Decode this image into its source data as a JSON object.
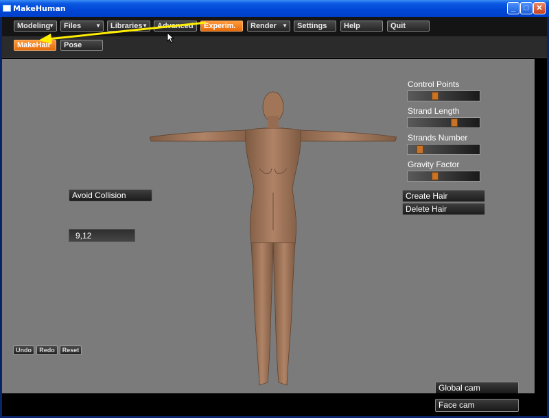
{
  "window": {
    "title": "MakeHuman"
  },
  "menu": {
    "tabs": [
      {
        "label": "Modeling",
        "dropdown": true
      },
      {
        "label": "Files",
        "dropdown": true
      },
      {
        "label": "Libraries",
        "dropdown": true
      },
      {
        "label": "Advanced",
        "dropdown": false
      },
      {
        "label": "Experim.",
        "dropdown": false,
        "active": true
      },
      {
        "label": "Render",
        "dropdown": true
      },
      {
        "label": "Settings",
        "dropdown": false
      },
      {
        "label": "Help",
        "dropdown": false
      },
      {
        "label": "Quit",
        "dropdown": false
      }
    ],
    "subtabs": [
      {
        "label": "MakeHair",
        "active": true
      },
      {
        "label": "Pose",
        "active": false
      }
    ]
  },
  "sliders": [
    {
      "label": "Control Points",
      "level": 0.38
    },
    {
      "label": "Strand Length",
      "level": 0.68
    },
    {
      "label": "Strands Number",
      "level": 0.14
    },
    {
      "label": "Gravity Factor",
      "level": 0.38
    }
  ],
  "buttons": {
    "avoid_collision": "Avoid Collision",
    "create_hair": "Create Hair",
    "delete_hair": "Delete Hair",
    "undo": "Undo",
    "redo": "Redo",
    "reset": "Reset",
    "global_cam": "Global cam",
    "face_cam": "Face cam"
  },
  "value_field": "9,12",
  "colors": {
    "accent": "#f08020",
    "viewport": "#7b7b7b",
    "skin": "#a47a5c",
    "annotation_arrow": "#ffee00"
  },
  "icons": {
    "window": "app-icon",
    "minimize": "minimize-icon",
    "maximize": "maximize-icon",
    "close": "close-icon",
    "pointer": "cursor-icon"
  }
}
